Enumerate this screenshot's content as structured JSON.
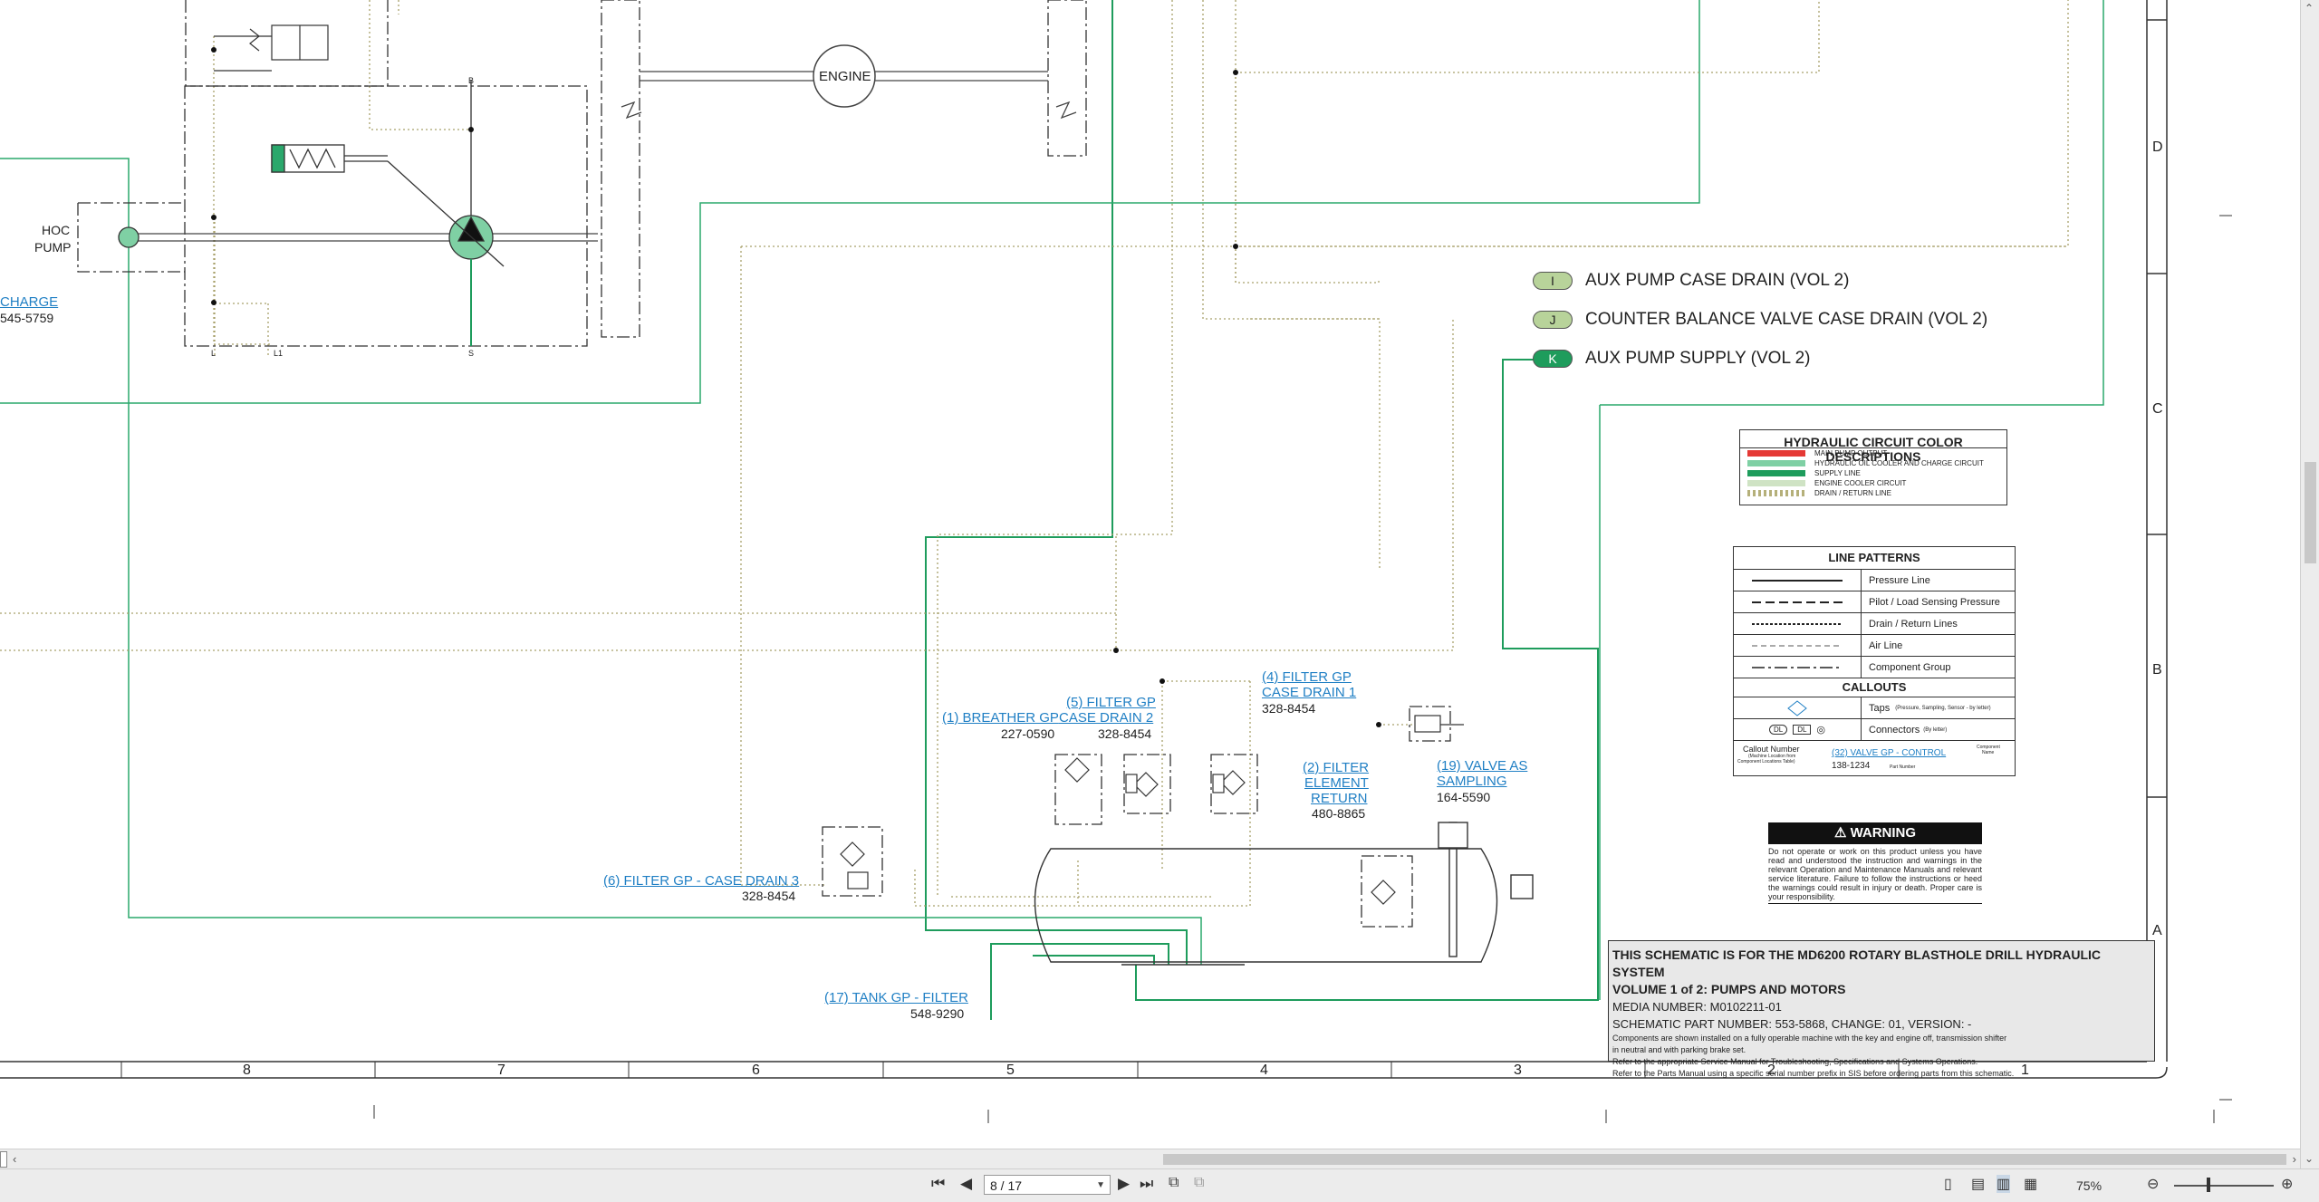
{
  "schematic": {
    "hoc_pump": [
      "HOC",
      "PUMP"
    ],
    "engine_label": "ENGINE",
    "port_labels": {
      "b": "B",
      "s": "S",
      "l": "L",
      "l1": "L1"
    },
    "partial_callout": {
      "name": "CHARGE",
      "part": "545-5759"
    },
    "connectors": [
      {
        "letter": "I",
        "text": "AUX PUMP CASE DRAIN (VOL 2)",
        "fill": "#b8d39a"
      },
      {
        "letter": "J",
        "text": "COUNTER BALANCE VALVE CASE DRAIN (VOL 2)",
        "fill": "#b8d39a"
      },
      {
        "letter": "K",
        "text": "AUX PUMP SUPPLY (VOL 2)",
        "fill": "#1e9c5c"
      }
    ],
    "callouts": {
      "breather": {
        "name": "(1) BREATHER GP",
        "part": "227-0590"
      },
      "filter5": {
        "name1": "(5) FILTER GP",
        "name2": "CASE DRAIN 2",
        "part": "328-8454"
      },
      "filter4": {
        "name1": "(4) FILTER GP",
        "name2": "CASE DRAIN 1",
        "part": "328-8454"
      },
      "filter2": {
        "name1": "(2) FILTER",
        "name2": "ELEMENT",
        "name3": "RETURN",
        "part": "480-8865"
      },
      "valve19": {
        "name1": "(19) VALVE AS",
        "name2": "SAMPLING",
        "part": "164-5590"
      },
      "filter6": {
        "name": "(6) FILTER GP - CASE DRAIN 3",
        "part": "328-8454"
      },
      "tank17": {
        "name": "(17) TANK GP - FILTER",
        "part": "548-9290"
      }
    },
    "zone_letters": [
      "D",
      "C",
      "B",
      "A"
    ],
    "zone_numbers": [
      "8",
      "7",
      "6",
      "5",
      "4",
      "3",
      "2",
      "1"
    ]
  },
  "legend_colors": {
    "title": "HYDRAULIC CIRCUIT COLOR DESCRIPTIONS",
    "items": [
      {
        "label": "MAIN PUMP OUTPUT",
        "color": "#e53935"
      },
      {
        "label": "HYDRAULIC OIL COOLER AND CHARGE CIRCUIT",
        "color": "#7fd0a4"
      },
      {
        "label": "SUPPLY LINE",
        "color": "#1e9c5c"
      },
      {
        "label": "ENGINE COOLER CIRCUIT",
        "color": "#cfe3c4"
      },
      {
        "label": "DRAIN / RETURN LINE",
        "color": "#b5b07a"
      }
    ]
  },
  "legend_lines": {
    "title": "LINE PATTERNS",
    "items": [
      "Pressure Line",
      "Pilot / Load Sensing Pressure",
      "Drain / Return Lines",
      "Air Line",
      "Component Group"
    ],
    "callouts_title": "CALLOUTS",
    "taps_label": "Taps",
    "taps_note": "(Pressure, Sampling, Sensor - by letter)",
    "connectors_label": "Connectors",
    "connectors_note": "(By letter)",
    "conn_dl1": "DL",
    "conn_dl2": "DL",
    "example_callout_number": "Callout Number",
    "example_callout_note1": "(Machine Location from",
    "example_callout_note2": "Component Locations Table)",
    "example_link": "(32) VALVE GP - CONTROL",
    "example_component": "Component",
    "example_name": "Name",
    "example_part": "138-1234",
    "example_part_label": "Part Number"
  },
  "warning": {
    "title": "WARNING",
    "text": "Do not operate or work on this product unless you have read and understood the instruction and warnings in the relevant Operation and Maintenance Manuals and relevant service literature. Failure to follow the instructions or heed the warnings could result in injury or death. Proper care is your responsibility."
  },
  "title_block": {
    "line1": "THIS SCHEMATIC IS FOR THE MD6200 ROTARY BLASTHOLE DRILL HYDRAULIC SYSTEM",
    "line2": "VOLUME 1 of 2: PUMPS AND MOTORS",
    "media": "MEDIA NUMBER: M0102211-01",
    "part": "SCHEMATIC PART NUMBER: 553-5868, CHANGE: 01, VERSION: -",
    "note1": "Components are shown installed on a fully operable machine with the key and engine off, transmission shifter",
    "note2": "in neutral and with parking brake set.",
    "note3": "Refer to the appropriate Service Manual for Troubleshooting, Specifications and Systems Operations.",
    "note4": "Refer to the Parts Manual using a specific serial number prefix in SIS before ordering parts from this schematic."
  },
  "toolbar": {
    "page_value": "8 / 17",
    "zoom": "75%"
  },
  "colors": {
    "supply": "#1e9c5c",
    "cooler": "#7fd0a4",
    "drain": "#b5b07a",
    "link": "#1f7fc4"
  }
}
